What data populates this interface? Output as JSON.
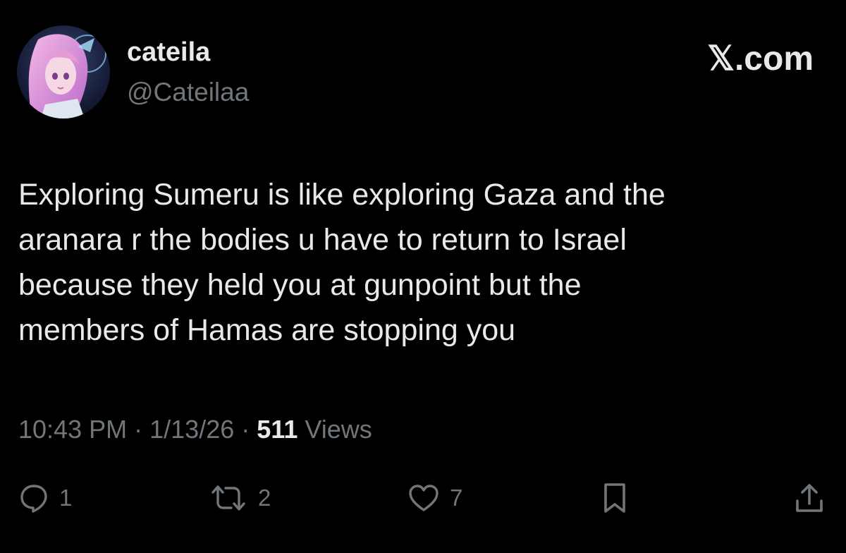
{
  "user": {
    "display_name": "cateila",
    "handle": "@Cateilaa"
  },
  "brand": {
    "label": "𝕏.com"
  },
  "tweet": {
    "lines": [
      "Exploring Sumeru is like exploring Gaza and the",
      "aranara r the bodies u have to return to Israel",
      "because they held you at gunpoint but the",
      "members of Hamas are stopping you"
    ]
  },
  "meta": {
    "time": "10:43 PM",
    "separator": "·",
    "date": "1/13/26",
    "views_count": "511",
    "views_label": "Views"
  },
  "actions": {
    "replies": "1",
    "reposts": "2",
    "likes": "7"
  },
  "icons": {
    "reply": "reply-icon",
    "repost": "repost-icon",
    "like": "heart-icon",
    "bookmark": "bookmark-icon",
    "share": "share-icon"
  },
  "colors": {
    "background": "#000000",
    "primary_text": "#e7e9ea",
    "secondary_text": "#71767b"
  }
}
